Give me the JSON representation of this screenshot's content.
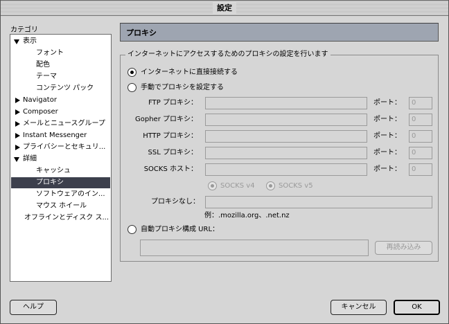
{
  "window": {
    "title": "設定"
  },
  "sidebar": {
    "label": "カテゴリ",
    "items": [
      {
        "label": "表示",
        "twisty": "open",
        "indent": 0
      },
      {
        "label": "フォント",
        "twisty": "",
        "indent": 2
      },
      {
        "label": "配色",
        "twisty": "",
        "indent": 2
      },
      {
        "label": "テーマ",
        "twisty": "",
        "indent": 2
      },
      {
        "label": "コンテンツ パック",
        "twisty": "",
        "indent": 2
      },
      {
        "label": "Navigator",
        "twisty": "closed",
        "indent": 0
      },
      {
        "label": "Composer",
        "twisty": "closed",
        "indent": 0
      },
      {
        "label": "メールとニュースグループ",
        "twisty": "closed",
        "indent": 0
      },
      {
        "label": "Instant Messenger",
        "twisty": "closed",
        "indent": 0
      },
      {
        "label": "プライバシーとセキュリ...",
        "twisty": "closed",
        "indent": 0
      },
      {
        "label": "詳細",
        "twisty": "open",
        "indent": 0
      },
      {
        "label": "キャッシュ",
        "twisty": "",
        "indent": 2
      },
      {
        "label": "プロキシ",
        "twisty": "",
        "indent": 2,
        "selected": true
      },
      {
        "label": "ソフトウェアのイン...",
        "twisty": "",
        "indent": 2
      },
      {
        "label": "マウス ホイール",
        "twisty": "",
        "indent": 2
      },
      {
        "label": "オフラインとディスク ス...",
        "twisty": "",
        "indent": 1
      }
    ]
  },
  "main": {
    "header": "プロキシ",
    "group_label": "インターネットにアクセスするためのプロキシの設定を行います",
    "radio_direct": "インターネットに直接接続する",
    "radio_manual": "手動でプロキシを設定する",
    "proxies": [
      {
        "label": "FTP プロキシ：",
        "port_label": "ポート：",
        "port_value": "0"
      },
      {
        "label": "Gopher プロキシ：",
        "port_label": "ポート：",
        "port_value": "0"
      },
      {
        "label": "HTTP プロキシ：",
        "port_label": "ポート：",
        "port_value": "0"
      },
      {
        "label": "SSL プロキシ：",
        "port_label": "ポート：",
        "port_value": "0"
      },
      {
        "label": "SOCKS ホスト：",
        "port_label": "ポート：",
        "port_value": "0"
      }
    ],
    "socks_v4": "SOCKS v4",
    "socks_v5": "SOCKS v5",
    "no_proxy_label": "プロキシなし：",
    "no_proxy_example": "例：.mozilla.org、.net.nz",
    "radio_auto": "自動プロキシ構成 URL：",
    "reload_button": "再読み込み",
    "selected_option": "direct"
  },
  "footer": {
    "help_button": "ヘルプ",
    "cancel_button": "キャンセル",
    "ok_button": "OK"
  }
}
